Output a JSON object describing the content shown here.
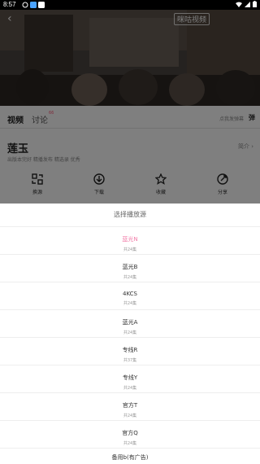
{
  "status_bar": {
    "time": "8:57"
  },
  "video": {
    "watermark": "咪咕视频"
  },
  "tabs": {
    "video": "视频",
    "comment": "讨论",
    "comment_badge": "66",
    "right_label": "点我发弹幕",
    "danmaku": "弹"
  },
  "show": {
    "title": "莲玉",
    "intro": "简介 ›",
    "subtitle": "出版本完好 精播发布 精选录 优秀"
  },
  "actions": [
    {
      "label": "换源",
      "icon": "swap-icon"
    },
    {
      "label": "下载",
      "icon": "download-icon"
    },
    {
      "label": "收藏",
      "icon": "star-icon"
    },
    {
      "label": "分享",
      "icon": "share-icon"
    }
  ],
  "sheet": {
    "title": "选择播放源",
    "lines": [
      {
        "name": "蓝光N",
        "count": "共24集",
        "active": true
      },
      {
        "name": "蓝光B",
        "count": "共24集",
        "active": false
      },
      {
        "name": "4KCS",
        "count": "共24集",
        "active": false
      },
      {
        "name": "蓝光A",
        "count": "共24集",
        "active": false
      },
      {
        "name": "专线R",
        "count": "共37集",
        "active": false
      },
      {
        "name": "专线Y",
        "count": "共24集",
        "active": false
      },
      {
        "name": "官方T",
        "count": "共24集",
        "active": false
      },
      {
        "name": "官方Q",
        "count": "共24集",
        "active": false
      },
      {
        "name": "备用b(有广告)",
        "count": "",
        "active": false
      }
    ]
  },
  "colors": {
    "accent": "#f27aa7",
    "dim": "#000000"
  }
}
